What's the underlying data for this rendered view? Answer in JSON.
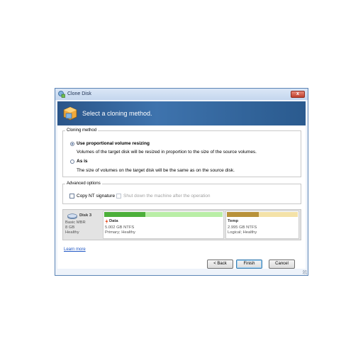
{
  "window": {
    "title": "Clone Disk",
    "close_label": "x"
  },
  "header": {
    "title": "Select a cloning method."
  },
  "cloning_method": {
    "legend": "Cloning method",
    "options": [
      {
        "label": "Use proportional volume resizing",
        "description": "Volumes of the target disk will be resized in proportion to the size of the source volumes.",
        "selected": true
      },
      {
        "label": "As is",
        "description": "The size of volumes on the target disk will be the same as on the source disk.",
        "selected": false
      }
    ]
  },
  "advanced_options": {
    "legend": "Advanced options",
    "copy_nt_signature": {
      "label": "Copy NT signature",
      "checked": false
    },
    "shutdown": {
      "label": "Shut down the machine after the operation",
      "checked": false,
      "enabled": false
    }
  },
  "disk_map": {
    "disk": {
      "name": "Disk 3",
      "type": "Basic MBR",
      "size": "8 GB",
      "status": "Healthy"
    },
    "partitions": [
      {
        "name": "Data",
        "size": "5.002 GB NTFS",
        "status": "Primary; Healthy",
        "used_fraction": 0.35,
        "color": "#4caf3a",
        "free_color": "#b9eea6"
      },
      {
        "name": "Temp",
        "size": "2.995 GB NTFS",
        "status": "Logical; Healthy",
        "used_fraction": 0.45,
        "color": "#b8923a",
        "free_color": "#f4e2a8"
      }
    ]
  },
  "links": {
    "learn_more": "Learn more"
  },
  "buttons": {
    "back": "< Back",
    "finish": "Finish",
    "cancel": "Cancel"
  }
}
